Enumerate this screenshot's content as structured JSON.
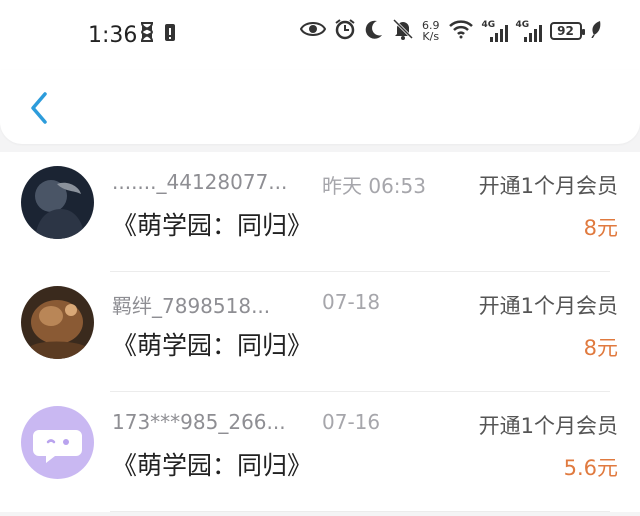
{
  "status_bar": {
    "time": "1:36",
    "net_speed_value": "6.9",
    "net_speed_unit": "K/s",
    "signal_tag_1": "4G",
    "signal_tag_2": "4G",
    "battery": "92"
  },
  "colors": {
    "accent": "#2d9cdb",
    "price": "#e07a3f"
  },
  "header": {
    "back_icon": "chevron-left-icon"
  },
  "records": [
    {
      "user": "......._44128077...",
      "date": "昨天 06:53",
      "action": "开通1个月会员",
      "book": "《萌学园：同归》",
      "price": "8元"
    },
    {
      "user": "羁绊_7898518...",
      "date": "07-18",
      "action": "开通1个月会员",
      "book": "《萌学园：同归》",
      "price": "8元"
    },
    {
      "user": "173***985_266...",
      "date": "07-16",
      "action": "开通1个月会员",
      "book": "《萌学园：同归》",
      "price": "5.6元"
    }
  ]
}
